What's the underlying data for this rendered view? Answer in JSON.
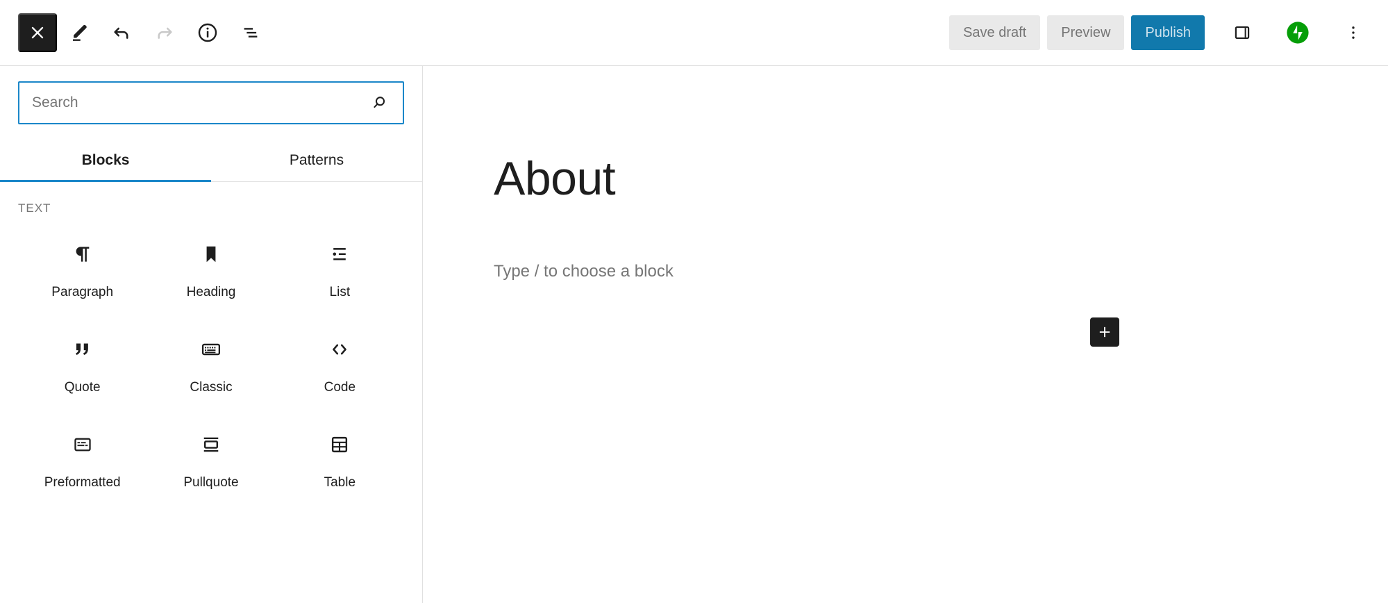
{
  "header": {
    "close_label": "Close block inserter",
    "icons": {
      "close": "close-icon",
      "edit": "pencil-icon",
      "undo": "undo-icon",
      "redo": "redo-icon",
      "info": "info-icon",
      "list_view": "list-view-icon",
      "sidebar_toggle": "sidebar-toggle-icon",
      "jetpack": "jetpack-icon",
      "more": "ellipsis-vertical-icon"
    },
    "save_draft_label": "Save draft",
    "preview_label": "Preview",
    "publish_label": "Publish",
    "colors": {
      "publish_bg": "#1179ac",
      "publish_text": "#cfe3ee",
      "secondary_bg": "#e9e9e9",
      "secondary_text": "#757575",
      "jetpack_green": "#069e08",
      "dark": "#1e1e1e"
    }
  },
  "inserter": {
    "search": {
      "value": "",
      "placeholder": "Search",
      "icon": "search-icon",
      "focus_color": "#1b87c9"
    },
    "tabs": [
      {
        "label": "Blocks",
        "active": true
      },
      {
        "label": "Patterns",
        "active": false
      }
    ],
    "categories": [
      {
        "label": "TEXT",
        "blocks": [
          {
            "label": "Paragraph",
            "icon": "paragraph-icon"
          },
          {
            "label": "Heading",
            "icon": "heading-icon"
          },
          {
            "label": "List",
            "icon": "list-icon"
          },
          {
            "label": "Quote",
            "icon": "quote-icon"
          },
          {
            "label": "Classic",
            "icon": "classic-keyboard-icon"
          },
          {
            "label": "Code",
            "icon": "code-icon"
          },
          {
            "label": "Preformatted",
            "icon": "preformatted-icon"
          },
          {
            "label": "Pullquote",
            "icon": "pullquote-icon"
          },
          {
            "label": "Table",
            "icon": "table-icon"
          }
        ]
      }
    ]
  },
  "canvas": {
    "post_title": "About",
    "block_placeholder": "Type / to choose a block",
    "add_block_icon": "plus-icon"
  }
}
